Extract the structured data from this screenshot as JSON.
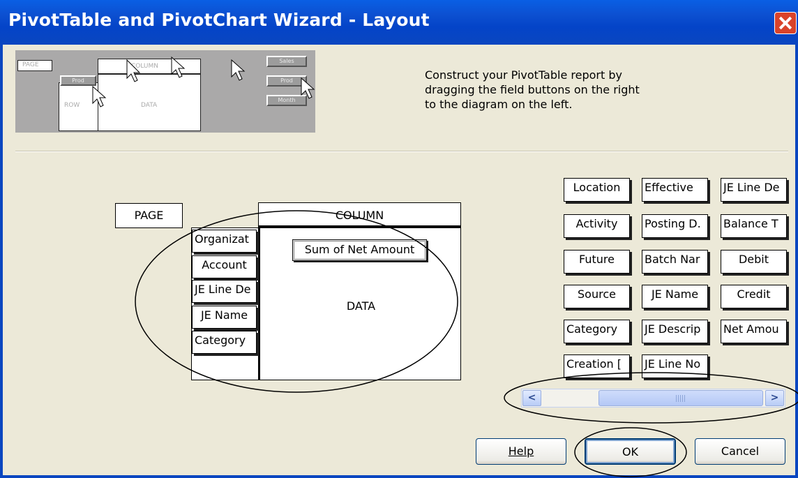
{
  "dialog": {
    "title": "PivotTable and PivotChart Wizard - Layout"
  },
  "preview": {
    "page": "PAGE",
    "column": "COLUMN",
    "row": "ROW",
    "data": "DATA",
    "prod": "Prod",
    "sales": "Sales",
    "prod2": "Prod",
    "month": "Month"
  },
  "instructions": {
    "line1": "Construct your PivotTable report by",
    "line2": "dragging the field buttons on the right",
    "line3": "to the diagram on the left."
  },
  "layout": {
    "page_label": "PAGE",
    "column_label": "COLUMN",
    "data_label": "DATA",
    "row_fields": [
      "Organizat",
      "Account",
      "JE Line De",
      "JE Name",
      "Category"
    ],
    "data_field": "Sum of Net Amount"
  },
  "fields": [
    [
      "Location",
      "Effective",
      "JE Line De"
    ],
    [
      "Activity",
      "Posting D.",
      "Balance T"
    ],
    [
      "Future",
      "Batch Nar",
      "Debit"
    ],
    [
      "Source",
      "JE Name",
      "Credit"
    ],
    [
      "Category",
      "JE Descrip",
      "Net Amou"
    ],
    [
      "Creation [",
      "JE Line No"
    ]
  ],
  "scrollbar": {
    "left": "<",
    "right": ">",
    "grip": "|||"
  },
  "buttons": {
    "help": "Help",
    "ok": "OK",
    "cancel": "Cancel"
  }
}
